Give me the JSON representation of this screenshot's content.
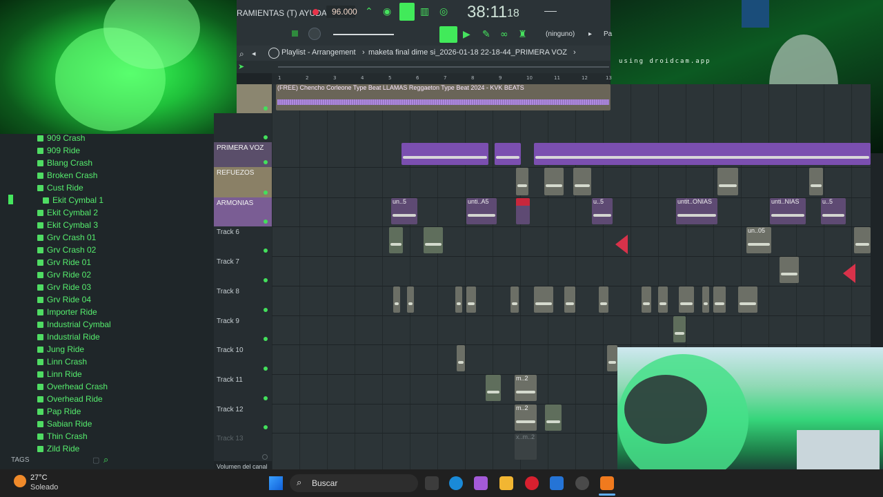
{
  "toolbar": {
    "menu_label": "RAMIENTAS (T) AYUDA",
    "tempo": "96.000",
    "time_main": "38:11",
    "time_sub": "18",
    "pattern_label": "(ninguno)",
    "p_label": "Pa"
  },
  "playlist": {
    "title": "Playlist - Arrangement",
    "breadcrumb": "maketa final dime si_2026-01-18 22-18-44_PRIMERA VOZ",
    "audio_clip_title": "(FREE) Chencho Corleone Type Beat LLAMAS  Reggaeton Type Beat 2024 - KVK BEATS",
    "ruler": [
      "1",
      "2",
      "3",
      "4",
      "5",
      "6",
      "7",
      "8",
      "9",
      "10",
      "11",
      "12",
      "13"
    ]
  },
  "tracks": [
    {
      "label": "PRIMERA VOZ"
    },
    {
      "label": "REFUEZOS"
    },
    {
      "label": "ARMONIAS"
    },
    {
      "label": "Track 6"
    },
    {
      "label": "Track 7"
    },
    {
      "label": "Track 8"
    },
    {
      "label": "Track 9"
    },
    {
      "label": "Track 10"
    },
    {
      "label": "Track 11"
    },
    {
      "label": "Track 12"
    },
    {
      "label": "Track 13"
    }
  ],
  "footer_label": "Volumen del canal",
  "clips": {
    "un5": "un..5",
    "unti_a5": "unti..A5",
    "u5": "u..5",
    "untit_onias": "untit..ONIAS",
    "unti_nias": "unti..NIAS",
    "un05": "un..05",
    "m2": "m..2",
    "xm2": "x..m..2"
  },
  "browser": {
    "items": [
      "909 Crash",
      "909 Ride",
      "Blang Crash",
      "Broken Crash",
      "Cust Ride",
      "Ekit Cymbal 1",
      "Ekit Cymbal 2",
      "Ekit Cymbal 3",
      "Grv Crash 01",
      "Grv Crash 02",
      "Grv Ride 01",
      "Grv Ride 02",
      "Grv Ride 03",
      "Grv Ride 04",
      "Importer Ride",
      "Industrial Cymbal",
      "Industrial Ride",
      "Jung Ride",
      "Linn Crash",
      "Linn Ride",
      "Overhead Crash",
      "Overhead Ride",
      "Pap Ride",
      "Sabian Ride",
      "Thin Crash",
      "Zild Ride"
    ],
    "tags_label": "TAGS"
  },
  "webcam": {
    "watermark": "using droidcam.app"
  },
  "taskbar": {
    "weather_temp": "27°C",
    "weather_desc": "Soleado",
    "search_label": "Buscar"
  },
  "colors": {
    "accent_green": "#41ea5a",
    "clip_purple": "#7b4fb0",
    "clip_gray": "#6c6f66",
    "clip_red": "#c8273c"
  }
}
